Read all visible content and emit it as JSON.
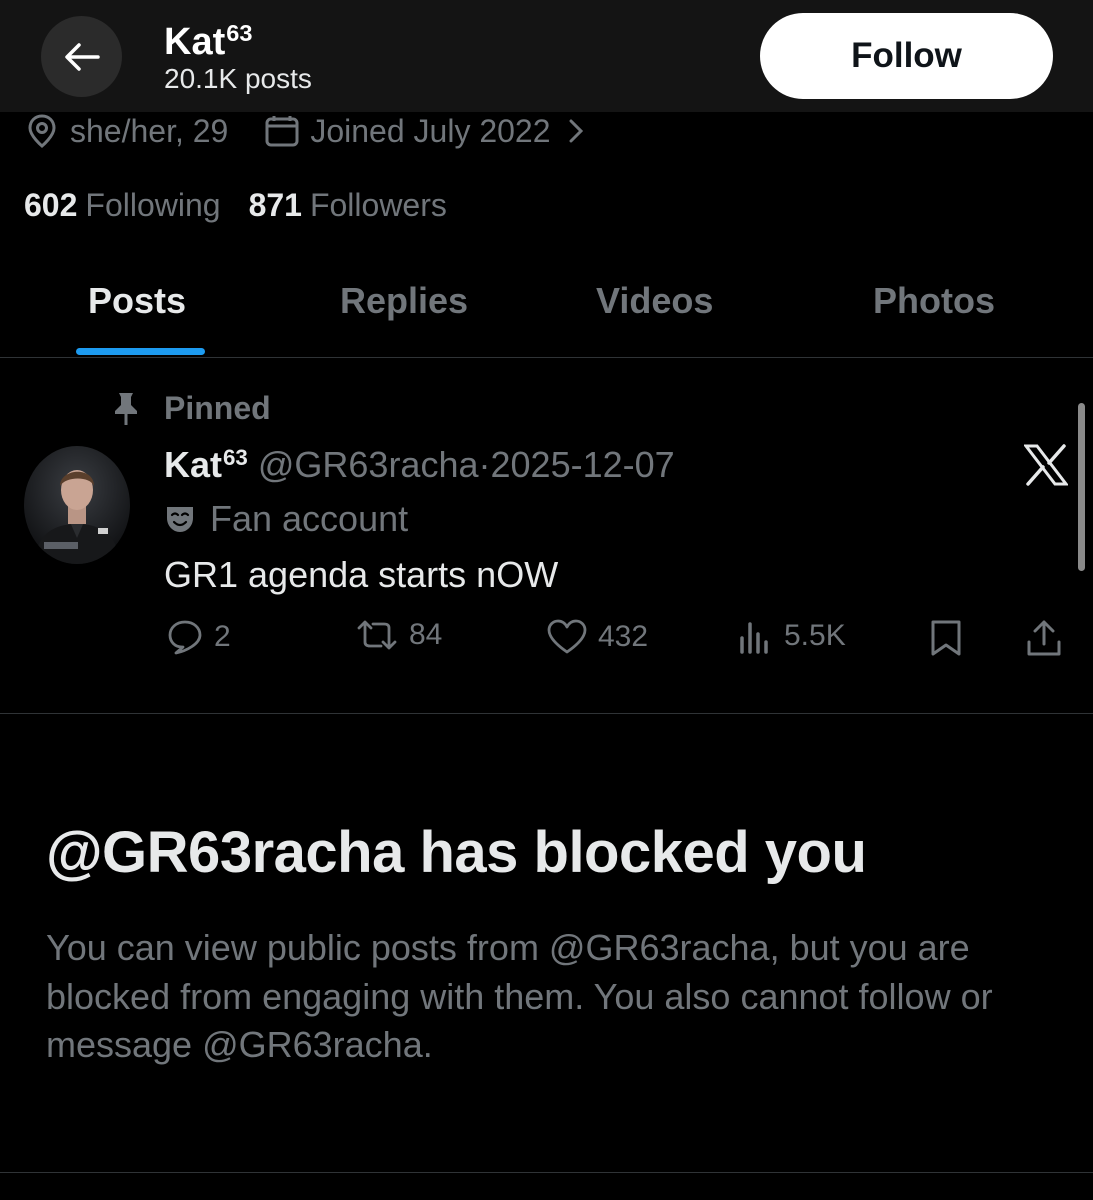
{
  "header": {
    "name": "Kat",
    "name_sup": "63",
    "posts_count": "20.1K posts",
    "follow_label": "Follow",
    "back_icon": "arrow-left-icon"
  },
  "profile": {
    "location": "she/her, 29",
    "joined": "Joined July 2022",
    "following_count": "602",
    "following_label": "Following",
    "followers_count": "871",
    "followers_label": "Followers"
  },
  "tabs": [
    {
      "label": "Posts",
      "active": true
    },
    {
      "label": "Replies",
      "active": false
    },
    {
      "label": "Videos",
      "active": false
    },
    {
      "label": "Photos",
      "active": false
    }
  ],
  "post": {
    "pinned_label": "Pinned",
    "name": "Kat",
    "name_sup": "63",
    "handle": "@GR63racha",
    "separator": "·",
    "date": "2025-12-07",
    "badge": "Fan account",
    "text": "GR1 agenda starts nOW",
    "replies": "2",
    "reposts": "84",
    "likes": "432",
    "views": "5.5K"
  },
  "blocked": {
    "title": "@GR63racha has blocked you",
    "body": "You can view public posts from @GR63racha, but you are blocked from engaging with them. You also cannot follow or message @GR63racha."
  },
  "colors": {
    "background": "#000000",
    "header_bg": "#141414",
    "primary_text": "#e7e9ea",
    "secondary_text": "#71767b",
    "accent": "#1d9bf0",
    "divider": "#2f3336"
  }
}
